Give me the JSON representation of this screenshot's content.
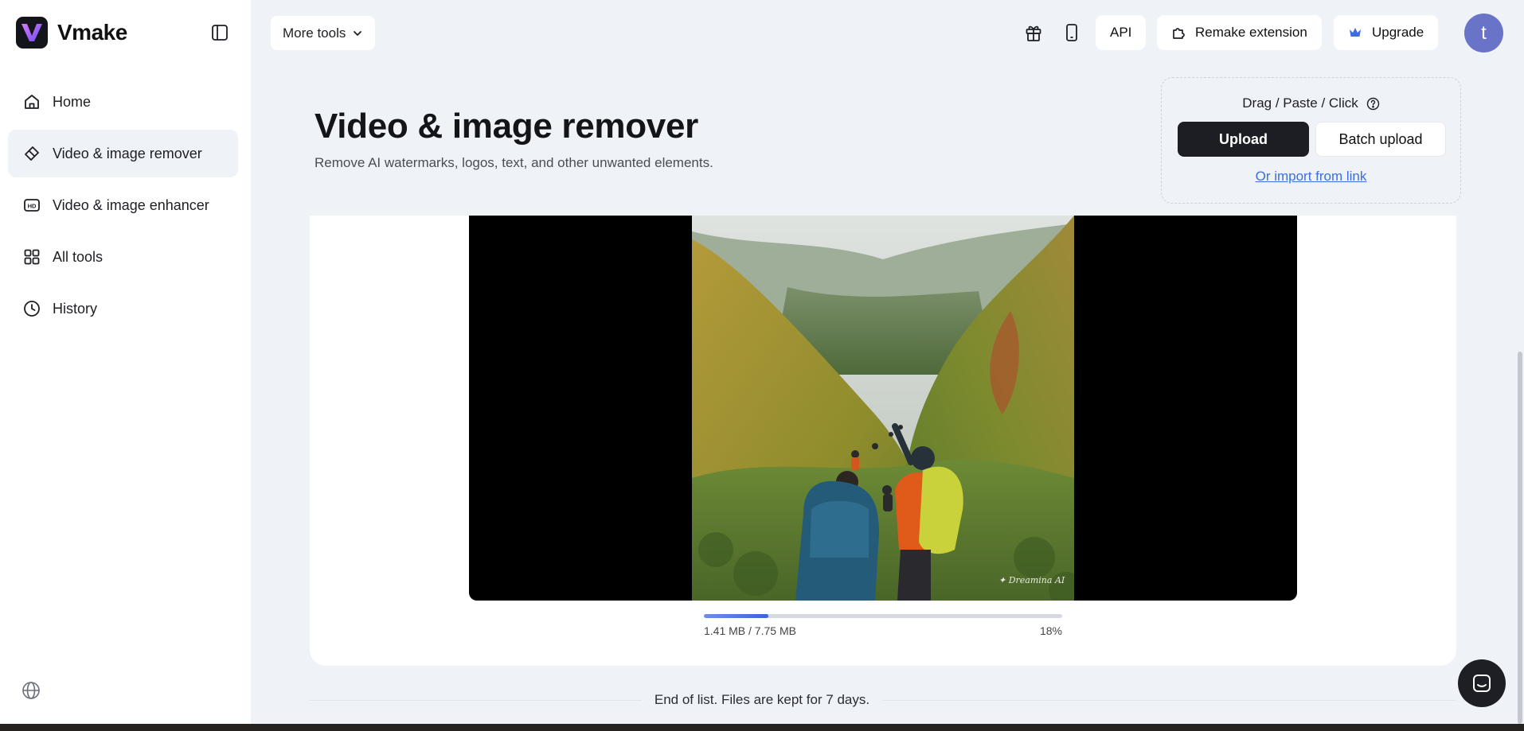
{
  "app": {
    "name": "Vmake"
  },
  "sidebar": {
    "items": [
      {
        "label": "Home",
        "icon": "home-icon",
        "active": false
      },
      {
        "label": "Video & image remover",
        "icon": "eraser-icon",
        "active": true
      },
      {
        "label": "Video & image enhancer",
        "icon": "hd-icon",
        "active": false
      },
      {
        "label": "All tools",
        "icon": "grid-icon",
        "active": false
      },
      {
        "label": "History",
        "icon": "clock-icon",
        "active": false
      }
    ]
  },
  "topbar": {
    "more_tools": "More tools",
    "api": "API",
    "remake_extension": "Remake extension",
    "upgrade": "Upgrade",
    "avatar_letter": "t"
  },
  "hero": {
    "title": "Video & image remover",
    "subtitle": "Remove AI watermarks, logos, text, and other unwanted elements."
  },
  "upload": {
    "drag_label": "Drag / Paste / Click",
    "upload_button": "Upload",
    "batch_button": "Batch upload",
    "import_link": "Or import from link"
  },
  "progress": {
    "size_text": "1.41 MB / 7.75 MB",
    "percent_text": "18%",
    "fraction": 0.18
  },
  "footer": {
    "end_text": "End of list. Files are kept for 7 days."
  },
  "colors": {
    "accent": "#3964e0",
    "avatar": "#6973c7",
    "dark_button": "#1c1e24"
  }
}
